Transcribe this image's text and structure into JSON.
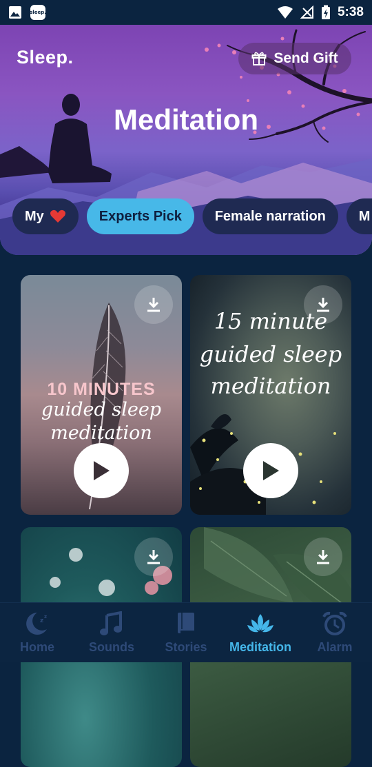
{
  "status_bar": {
    "time": "5:38",
    "app_badge": "sleep."
  },
  "header": {
    "brand": "Sleep.",
    "gift_label": "Send Gift",
    "title": "Meditation"
  },
  "chips": [
    {
      "label": "My",
      "icon": "heart-icon",
      "active": false
    },
    {
      "label": "Experts Pick",
      "active": true
    },
    {
      "label": "Female narration",
      "active": false
    },
    {
      "label": "M",
      "active": false
    }
  ],
  "cards": [
    {
      "lines": [
        "10 MINUTES",
        "guided sleep",
        "meditation"
      ]
    },
    {
      "lines": [
        "15 minute",
        "guided sleep",
        "meditation"
      ]
    },
    {
      "lines": []
    },
    {
      "lines": []
    }
  ],
  "nav": [
    {
      "label": "Home",
      "icon": "moon-icon",
      "active": false
    },
    {
      "label": "Sounds",
      "icon": "music-note-icon",
      "active": false
    },
    {
      "label": "Stories",
      "icon": "book-icon",
      "active": false
    },
    {
      "label": "Meditation",
      "icon": "lotus-icon",
      "active": true
    },
    {
      "label": "Alarm",
      "icon": "alarm-clock-icon",
      "active": false
    }
  ],
  "colors": {
    "accent": "#45b7ea",
    "background": "#0b2440",
    "nav_inactive": "#2e4a78",
    "heart": "#e53935"
  }
}
